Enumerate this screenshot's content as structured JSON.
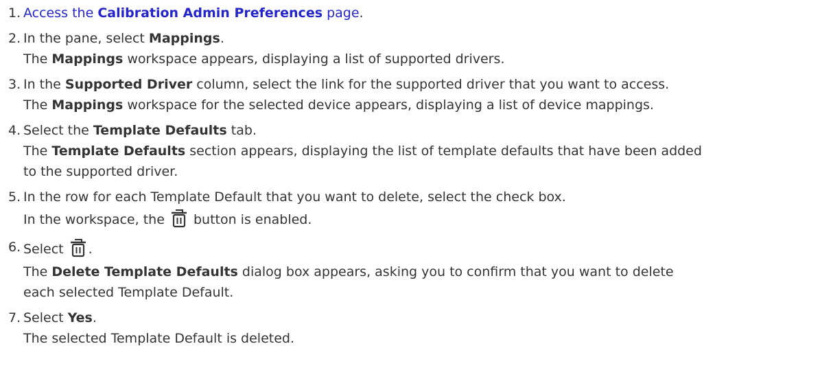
{
  "steps": [
    {
      "num": "1.",
      "parts": [
        "Access the ",
        "Calibration Admin Preferences",
        " page",
        "."
      ]
    },
    {
      "num": "2.",
      "parts": [
        "In the pane, select ",
        "Mappings",
        "."
      ],
      "result": [
        "The ",
        "Mappings",
        " workspace appears, displaying a list of supported drivers."
      ]
    },
    {
      "num": "3.",
      "parts": [
        "In the ",
        "Supported Driver",
        " column, select the link for the supported driver that you want to access."
      ],
      "result": [
        "The ",
        "Mappings",
        " workspace for the selected device appears, displaying a list of device mappings."
      ]
    },
    {
      "num": "4.",
      "parts": [
        "Select the ",
        "Template Defaults",
        " tab."
      ],
      "result": [
        "The ",
        "Template Defaults",
        " section appears, displaying the list of template defaults that have been added",
        "to the supported driver."
      ]
    },
    {
      "num": "5.",
      "parts": [
        "In the row for each Template Default that you want to delete, select the check box."
      ],
      "result": [
        "In the workspace, the ",
        " button is enabled."
      ]
    },
    {
      "num": "6.",
      "parts": [
        "Select ",
        "."
      ],
      "result": [
        "The ",
        "Delete Template Defaults",
        " dialog box appears, asking you to confirm that you want to delete",
        "each selected Template Default."
      ]
    },
    {
      "num": "7.",
      "parts": [
        "Select ",
        "Yes",
        "."
      ],
      "result": [
        "The selected Template Default is deleted."
      ]
    }
  ],
  "icons": {
    "delete": "trash-icon"
  },
  "colors": {
    "link": "#2424cc",
    "text": "#333333"
  }
}
